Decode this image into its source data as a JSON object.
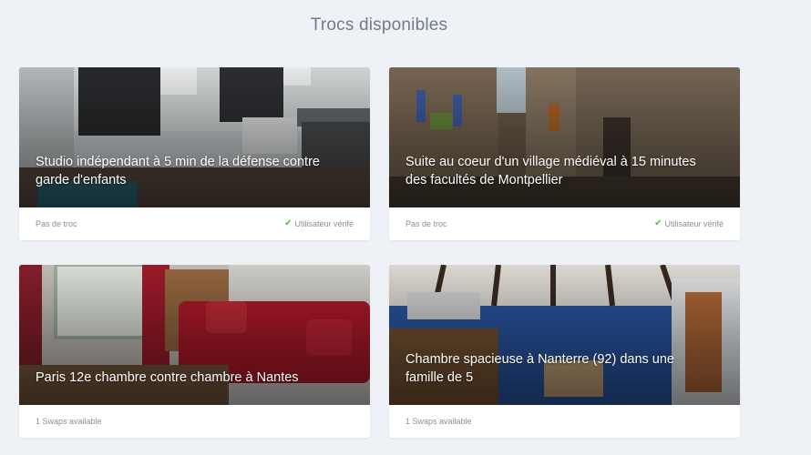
{
  "page": {
    "title": "Trocs disponibles"
  },
  "cards": [
    {
      "title": "Studio indépendant à 5 min de la défense contre garde d'enfants",
      "swap": "Pas de troc",
      "verified": "Utilisateur vérifé"
    },
    {
      "title": "Suite au coeur d'un village médiéval à 15 minutes des facultés de Montpellier",
      "swap": "Pas de troc",
      "verified": "Utilisateur vérifé"
    },
    {
      "title": "Paris 12e chambre contre chambre à Nantes",
      "swap": "1 Swaps available"
    },
    {
      "title": "Chambre spacieuse à Nanterre (92) dans une famille de 5",
      "swap": "1 Swaps available"
    }
  ],
  "icons": {
    "verified": "check-icon"
  },
  "colors": {
    "background": "#eef1f5",
    "verified": "#5fb34a",
    "title": "#6f7b8b"
  }
}
